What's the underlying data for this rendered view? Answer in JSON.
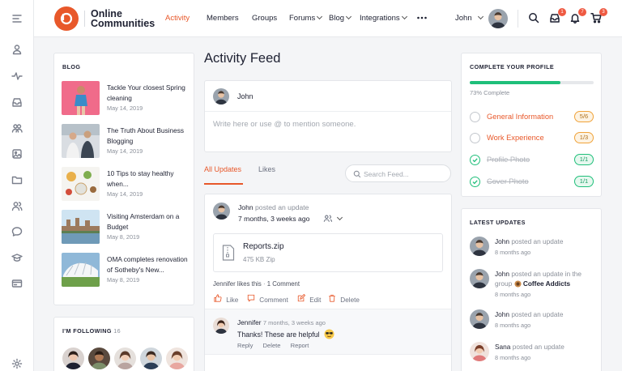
{
  "header": {
    "brand_line1": "Online",
    "brand_line2": "Communities",
    "nav": [
      {
        "label": "Activity",
        "active": true
      },
      {
        "label": "Members"
      },
      {
        "label": "Groups"
      },
      {
        "label": "Forums",
        "dropdown": true
      },
      {
        "label": "Blog",
        "dropdown": true
      },
      {
        "label": "Integrations",
        "dropdown": true
      }
    ],
    "more_icon": "more-dots-icon",
    "user_name": "John",
    "badges": {
      "inbox": "1",
      "notifications": "7",
      "cart": "3"
    },
    "accent": "#e8582a"
  },
  "sidebar_icons": [
    "menu-icon",
    "profile-icon",
    "activity-icon",
    "inbox-icon",
    "groups-icon",
    "photos-icon",
    "folder-icon",
    "members-icon",
    "forums-icon",
    "courses-icon",
    "card-icon",
    "settings-icon"
  ],
  "blog": {
    "title": "BLOG",
    "items": [
      {
        "title": "Tackle Your closest Spring cleaning",
        "date": "May 14, 2019"
      },
      {
        "title": "The Truth About Business Blogging",
        "date": "May 14, 2019"
      },
      {
        "title": "10 Tips to stay healthy when...",
        "date": "May 14, 2019"
      },
      {
        "title": "Visiting Amsterdam on a Budget",
        "date": "May 8, 2019"
      },
      {
        "title": "OMA completes renovation of Sotheby's New...",
        "date": "May 8, 2019"
      }
    ]
  },
  "following": {
    "title": "I'M FOLLOWING",
    "count": "16"
  },
  "feed": {
    "title": "Activity Feed",
    "composer_user": "John",
    "composer_placeholder": "Write here or use @ to mention someone.",
    "tabs": [
      {
        "label": "All Updates",
        "active": true
      },
      {
        "label": "Likes"
      }
    ],
    "search_placeholder": "Search Feed...",
    "post": {
      "user": "John",
      "action": "posted an update",
      "time": "7 months, 3 weeks ago",
      "file_name": "Reports.zip",
      "file_meta": "475 KB  Zip",
      "likes_text": "Jennifer likes this",
      "comments_text": "1 Comment",
      "actions": [
        "Like",
        "Comment",
        "Edit",
        "Delete"
      ]
    },
    "comment": {
      "user": "Jennifer",
      "time": "7 months, 3 weeks ago",
      "text": "Thanks! These are helpful",
      "actions": [
        "Reply",
        "Delete",
        "Report"
      ]
    }
  },
  "profile": {
    "title": "COMPLETE YOUR PROFILE",
    "progress": 73,
    "progress_label": "73% Complete",
    "progress_color": "#1fbf7a",
    "items": [
      {
        "label": "General Information",
        "value": "5/6",
        "done": false
      },
      {
        "label": "Work Experience",
        "value": "1/3",
        "done": false
      },
      {
        "label": "Profile Photo",
        "value": "1/1",
        "done": true
      },
      {
        "label": "Cover Photo",
        "value": "1/1",
        "done": true
      }
    ]
  },
  "latest": {
    "title": "LATEST UPDATES",
    "items": [
      {
        "user": "John",
        "text": "posted an update",
        "time": "8 months ago"
      },
      {
        "user": "John",
        "text": "posted an update in the group",
        "group": "Coffee Addicts",
        "time": "8 months ago"
      },
      {
        "user": "John",
        "text": "posted an update",
        "time": "8 months ago"
      },
      {
        "user": "Sana",
        "text": "posted an update",
        "time": "8 months ago"
      }
    ]
  }
}
